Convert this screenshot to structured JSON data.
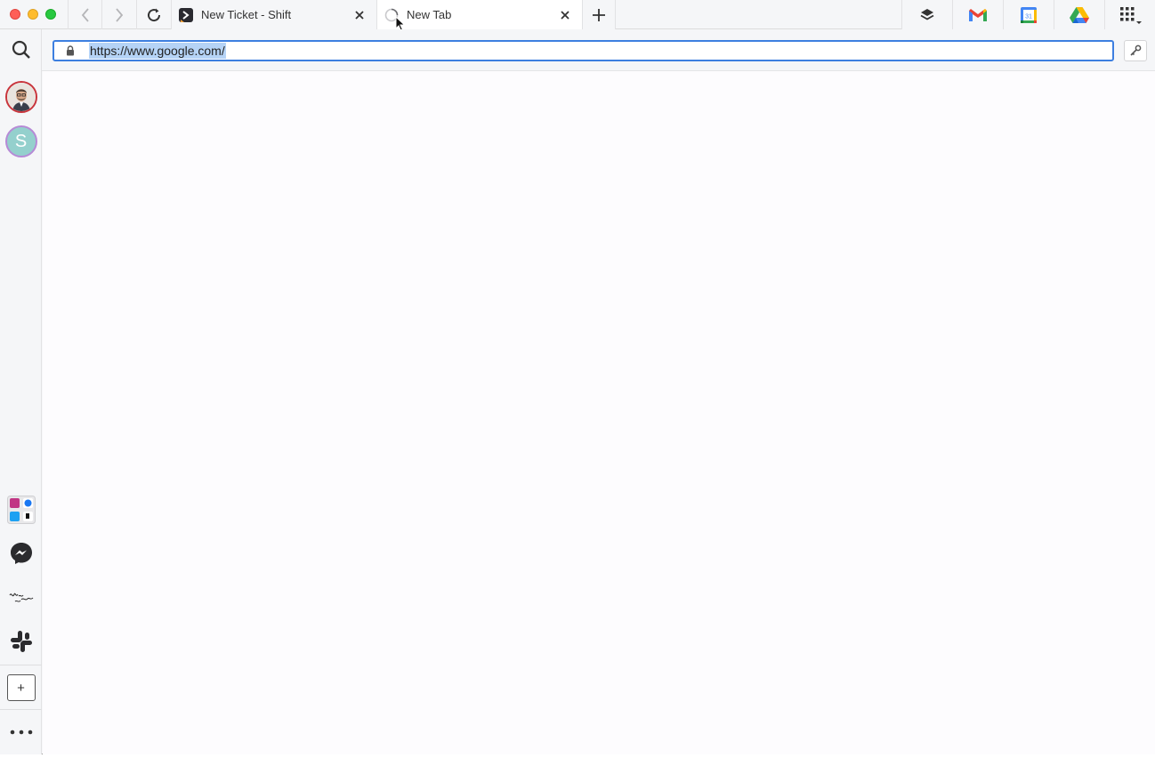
{
  "tabs": [
    {
      "label": "New Ticket - Shift",
      "state": "inactive",
      "icon": "shift-logo-icon"
    },
    {
      "label": "New Tab",
      "state": "active",
      "icon": "loading-spinner-icon"
    }
  ],
  "address_bar": {
    "url": "https://www.google.com/",
    "selected": true
  },
  "toolbar_apps": [
    "layers-icon",
    "gmail-icon",
    "google-calendar-icon",
    "google-drive-icon",
    "apps-grid-icon"
  ],
  "calendar_day": "31",
  "sidebar": {
    "accounts": [
      {
        "type": "photo",
        "name": "account-avatar-photo"
      },
      {
        "type": "initial",
        "initial": "S"
      }
    ],
    "apps": [
      "social-apps-group-icon",
      "messenger-icon",
      "workshop-logo-icon",
      "slack-icon"
    ],
    "add_label": "+",
    "more_label": "•••"
  },
  "colors": {
    "accent_blue": "#3d7fe0",
    "selection": "#b5d3f6",
    "avatar_ring": "#c8343b",
    "avatar_s_bg": "#94d0cd",
    "avatar_s_ring": "#b68ad6"
  }
}
